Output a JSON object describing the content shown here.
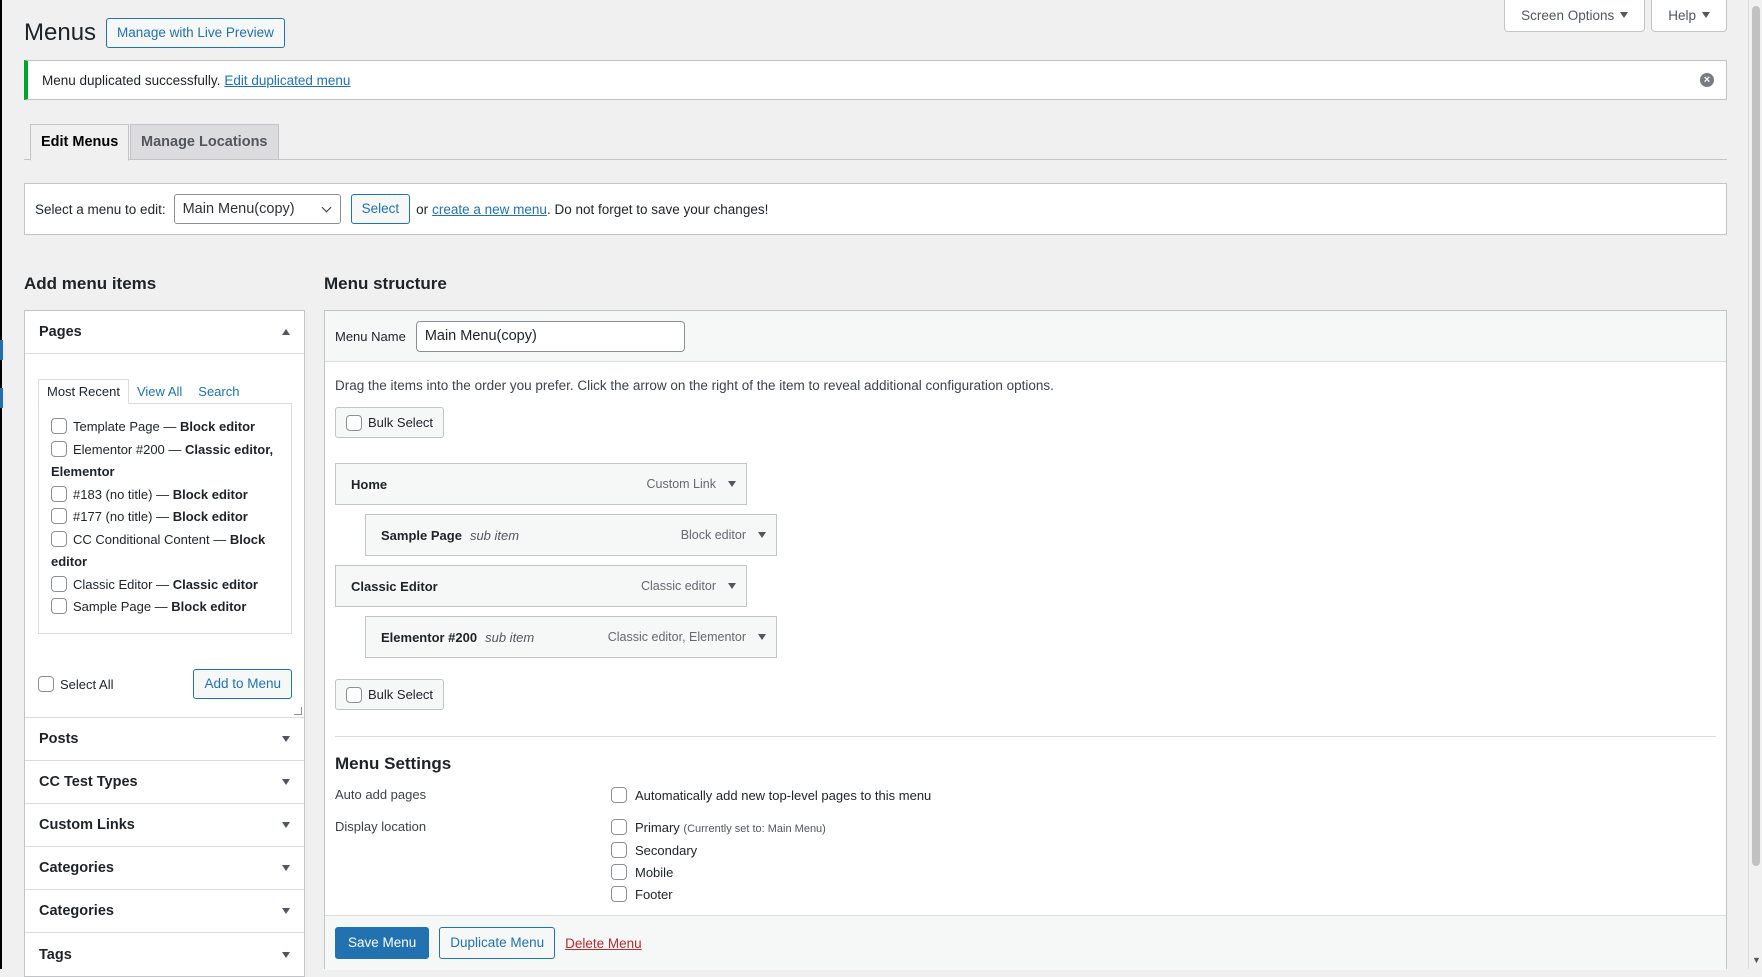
{
  "header": {
    "title": "Menus",
    "live_preview_label": "Manage with Live Preview",
    "screen_options_label": "Screen Options",
    "help_label": "Help"
  },
  "notice": {
    "text": "Menu duplicated successfully.",
    "link_text": "Edit duplicated menu",
    "dismiss_glyph": "×"
  },
  "tabs": {
    "edit_menus": "Edit Menus",
    "manage_locations": "Manage Locations"
  },
  "manage": {
    "label": "Select a menu to edit:",
    "selected_menu": "Main Menu(copy)",
    "select_button": "Select",
    "or_text": "or",
    "create_link": "create a new menu",
    "suffix": ". Do not forget to save your changes!"
  },
  "add_items": {
    "heading": "Add menu items",
    "pages": {
      "title": "Pages",
      "tabs": [
        "Most Recent",
        "View All",
        "Search"
      ],
      "items": [
        {
          "name": "Template Page",
          "sep": " — ",
          "type": "Block editor"
        },
        {
          "name": "Elementor #200",
          "sep": " — ",
          "type": "Classic editor, Elementor"
        },
        {
          "name": "#183 (no title)",
          "sep": " — ",
          "type": "Block editor"
        },
        {
          "name": "#177 (no title)",
          "sep": " — ",
          "type": "Block editor"
        },
        {
          "name": "CC Conditional Content",
          "sep": " — ",
          "type": "Block editor"
        },
        {
          "name": "Classic Editor",
          "sep": " — ",
          "type": "Classic editor"
        },
        {
          "name": "Sample Page",
          "sep": " — ",
          "type": "Block editor"
        }
      ],
      "select_all": "Select All",
      "add_button": "Add to Menu"
    },
    "sections": [
      "Posts",
      "CC Test Types",
      "Custom Links",
      "Categories",
      "Categories",
      "Tags"
    ]
  },
  "structure": {
    "heading": "Menu structure",
    "menu_name_label": "Menu Name",
    "menu_name_value": "Main Menu(copy)",
    "instructions": "Drag the items into the order you prefer. Click the arrow on the right of the item to reveal additional configuration options.",
    "bulk_select": "Bulk Select",
    "items": [
      {
        "title": "Home",
        "sub": "",
        "type": "Custom Link"
      },
      {
        "title": "Sample Page",
        "sub": "sub item",
        "type": "Block editor"
      },
      {
        "title": "Classic Editor",
        "sub": "",
        "type": "Classic editor"
      },
      {
        "title": "Elementor #200",
        "sub": "sub item",
        "type": "Classic editor, Elementor"
      }
    ]
  },
  "settings": {
    "title": "Menu Settings",
    "auto_add_label": "Auto add pages",
    "auto_add_option": "Automatically add new top-level pages to this menu",
    "display_label": "Display location",
    "locations": [
      {
        "name": "Primary",
        "note": "(Currently set to: Main Menu)"
      },
      {
        "name": "Secondary",
        "note": ""
      },
      {
        "name": "Mobile",
        "note": ""
      },
      {
        "name": "Footer",
        "note": ""
      }
    ]
  },
  "footer": {
    "save": "Save Menu",
    "duplicate": "Duplicate Menu",
    "delete": "Delete Menu"
  }
}
